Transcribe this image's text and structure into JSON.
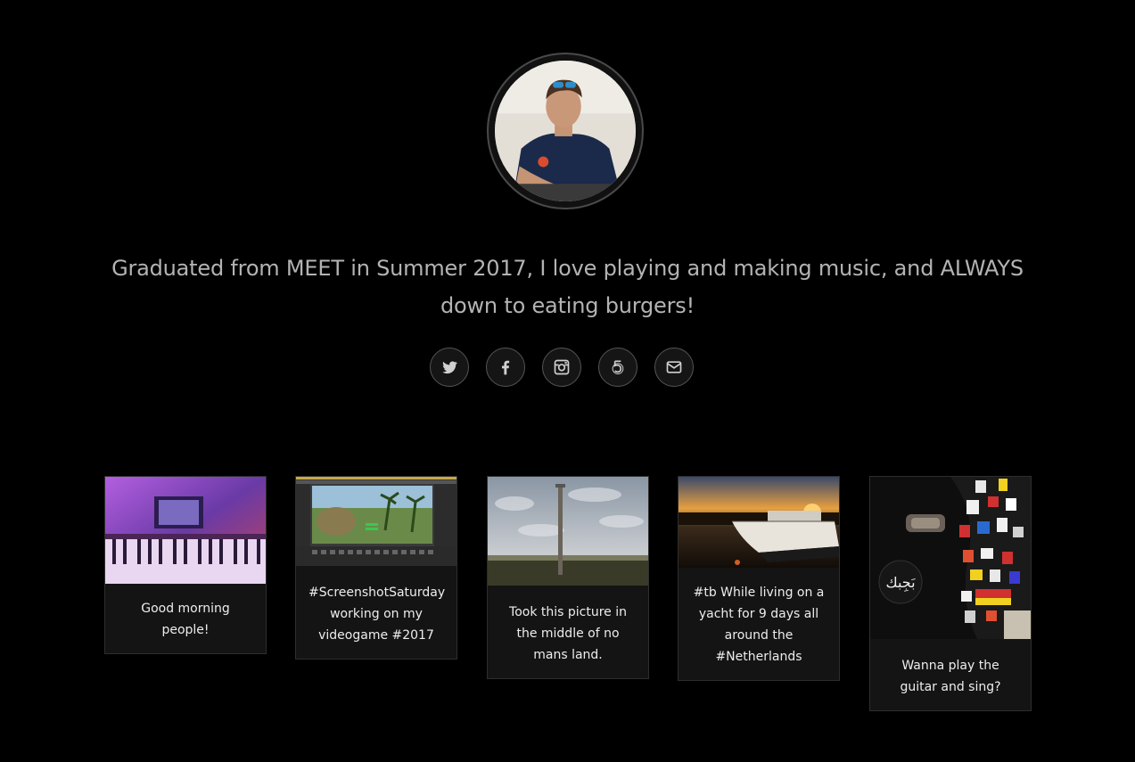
{
  "profile": {
    "bio": "Graduated from MEET in Summer 2017, I love playing and making music, and ALWAYS down to eating burgers!"
  },
  "social": [
    {
      "icon": "twitter-icon"
    },
    {
      "icon": "facebook-icon"
    },
    {
      "icon": "instagram-icon"
    },
    {
      "icon": "500px-icon"
    },
    {
      "icon": "email-icon"
    }
  ],
  "posts": [
    {
      "caption": "Good morning people!"
    },
    {
      "caption": "#ScreenshotSaturday working on my videogame #2017"
    },
    {
      "caption": "Took this picture in the middle of no mans land."
    },
    {
      "caption": "#tb While living on a yacht for 9 days all around the #Netherlands"
    },
    {
      "caption": "Wanna play the guitar and sing?"
    }
  ],
  "sticker_text": "بَجِبك",
  "colors": {
    "background": "#000000",
    "text_muted": "#b3b3b3",
    "card_bg": "#141414",
    "card_border": "#2e2e2e"
  }
}
